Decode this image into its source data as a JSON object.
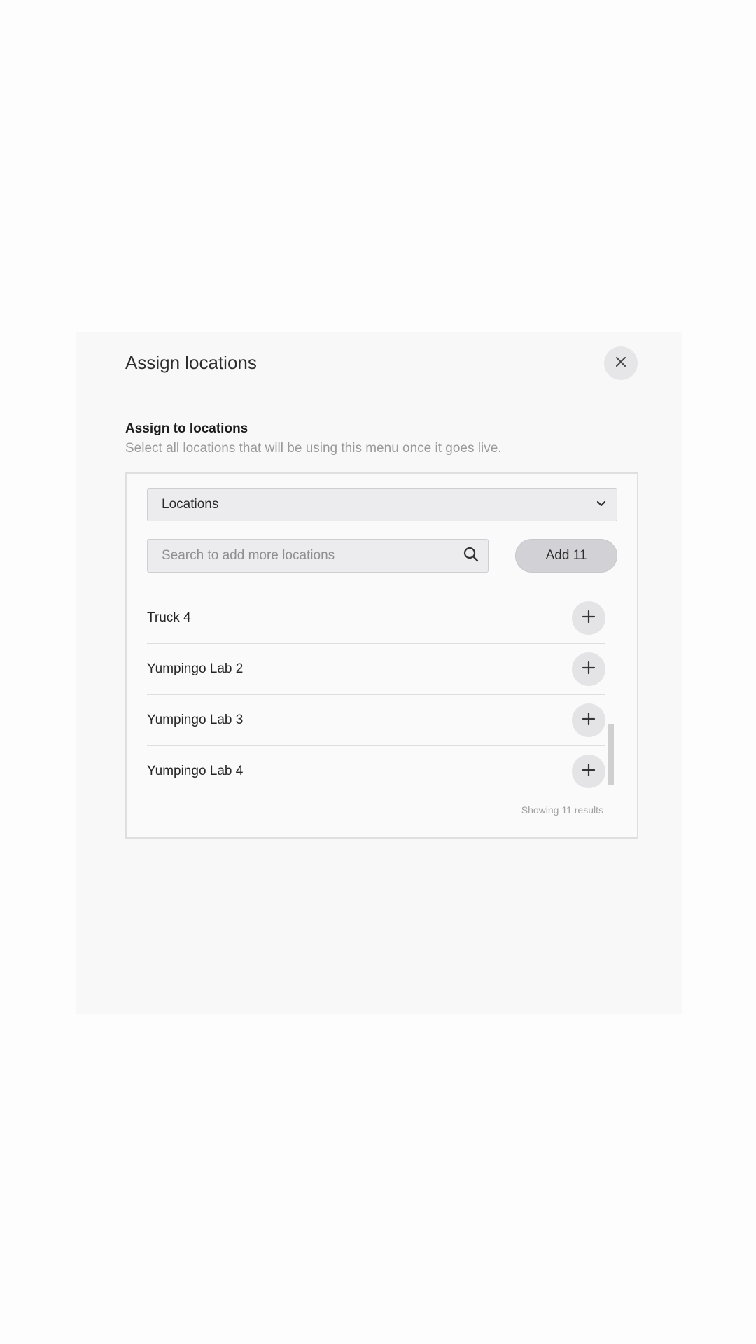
{
  "modal": {
    "title": "Assign locations",
    "close_icon": "close-icon"
  },
  "section": {
    "heading": "Assign to locations",
    "description": "Select all locations that will be using this menu once it goes live."
  },
  "locations_select": {
    "label": "Locations",
    "icon": "chevron-down-icon"
  },
  "search": {
    "placeholder": "Search to add more locations",
    "value": "",
    "icon": "search-icon"
  },
  "add_button": {
    "label": "Add 11"
  },
  "list": {
    "items": [
      {
        "label": "Truck 4",
        "icon": "plus-icon"
      },
      {
        "label": "Yumpingo Lab 2",
        "icon": "plus-icon"
      },
      {
        "label": "Yumpingo Lab 3",
        "icon": "plus-icon"
      },
      {
        "label": "Yumpingo Lab 4",
        "icon": "plus-icon"
      }
    ]
  },
  "results_text": "Showing 11 results"
}
